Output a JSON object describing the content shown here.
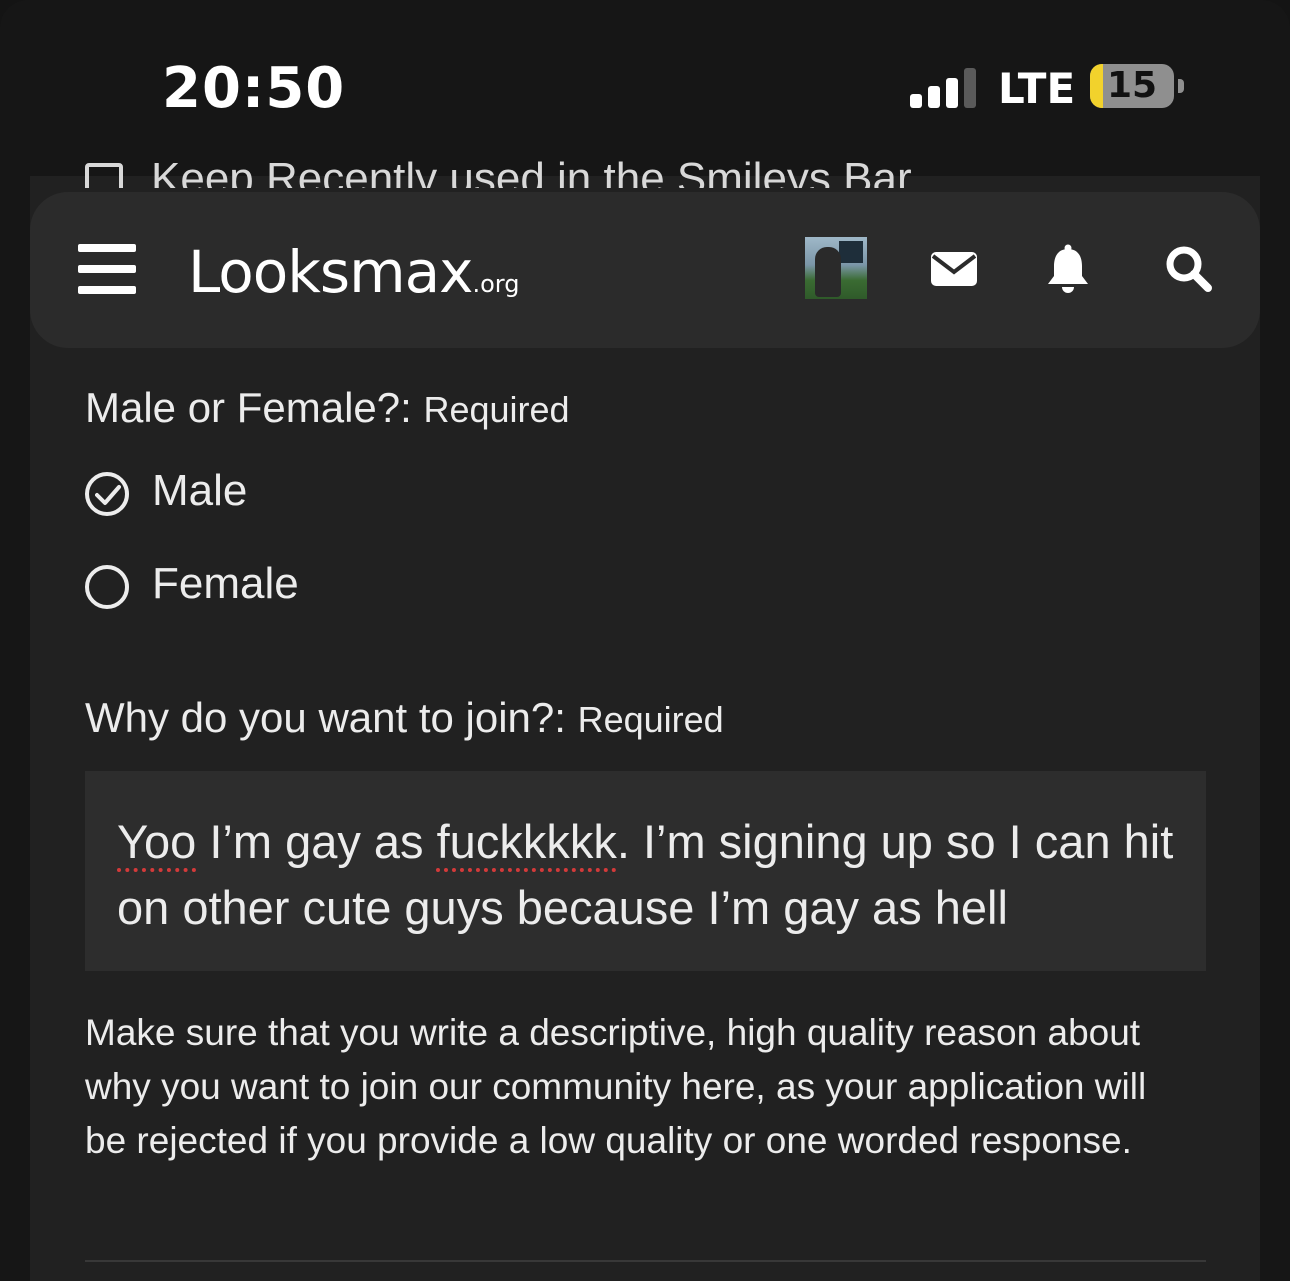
{
  "status_bar": {
    "time": "20:50",
    "network": "LTE",
    "battery_level": "15"
  },
  "behind_text": "Keep Recently used in the Smileys Bar",
  "navbar": {
    "logo": "Looksmax",
    "logo_suffix": ".org",
    "icons": [
      "menu-icon",
      "avatar",
      "mail-icon",
      "bell-icon",
      "search-icon"
    ]
  },
  "form": {
    "gender": {
      "label": "Male or Female?:",
      "required": "Required",
      "options": [
        {
          "label": "Male",
          "selected": true
        },
        {
          "label": "Female",
          "selected": false
        }
      ]
    },
    "reason": {
      "label": "Why do you want to join?:",
      "required": "Required",
      "value": {
        "word1": "Yoo",
        "part2": " I’m gay as ",
        "word2": "fuckkkkk",
        "part3": ". I’m signing up so I can hit on other cute guys because I’m gay as hell"
      },
      "help": "Make sure that you write a descriptive, high quality reason about why you want to join our community here, as your application will be rejected if you provide a low quality or one worded response."
    }
  },
  "colors": {
    "page_bg": "#212121",
    "navbar_bg": "#2b2b2b",
    "textarea_bg": "#2d2d2d",
    "spellcheck": "#d23a3a",
    "battery": "#f2d22c"
  }
}
